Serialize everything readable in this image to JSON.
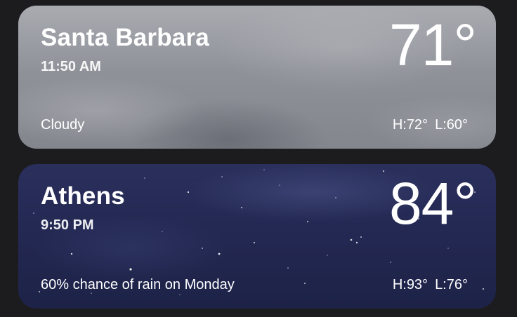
{
  "locations": [
    {
      "city": "Santa Barbara",
      "time": "11:50 AM",
      "temperature": "71°",
      "condition": "Cloudy",
      "high": "H:72°",
      "low": "L:60°",
      "background": "cloudy"
    },
    {
      "city": "Athens",
      "time": "9:50 PM",
      "temperature": "84°",
      "condition": "60% chance of rain on Monday",
      "high": "H:93°",
      "low": "L:76°",
      "background": "night-clear"
    }
  ],
  "colors": {
    "page_background": "#1c1c1e",
    "cloudy_card": "#8f9299",
    "night_card": "#232852",
    "text": "#ffffff"
  }
}
